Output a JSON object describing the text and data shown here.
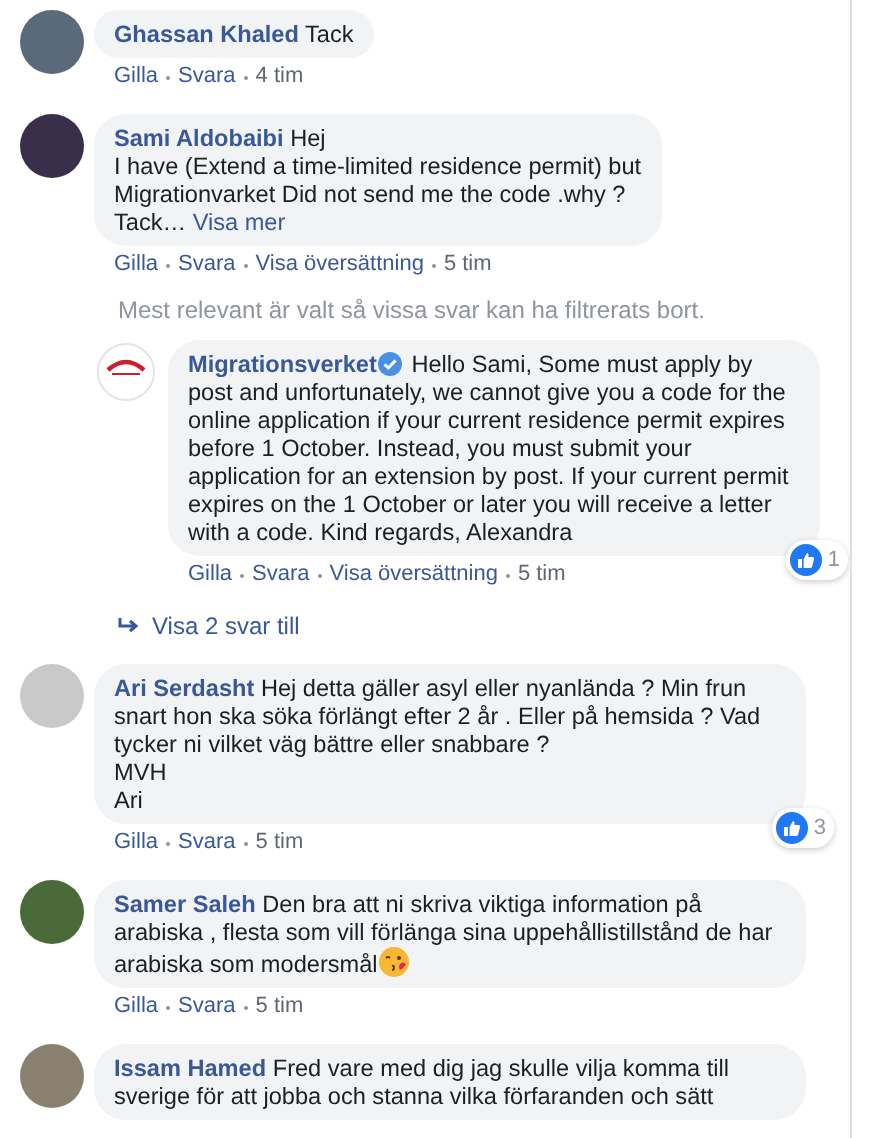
{
  "comments": [
    {
      "author": "Ghassan Khaled",
      "text": "Tack",
      "actions": [
        "Gilla",
        "Svara"
      ],
      "time": "4 tim"
    },
    {
      "author": "Sami Aldobaibi",
      "text": "Hej\nI have (Extend a time-limited residence permit) but\nMigrationvarket Did not send me the code .why ?\nTack…",
      "more_link": "Visa mer",
      "actions": [
        "Gilla",
        "Svara",
        "Visa översättning"
      ],
      "time": "5 tim",
      "filter_notice": "Mest relevant är valt så vissa svar kan ha filtrerats bort.",
      "replies": [
        {
          "author": "Migrationsverket",
          "verified": true,
          "text": "Hello Sami, Some must apply by post and unfortunately, we cannot give you a code for the online application if your current residence permit expires before 1 October. Instead, you must submit your application for an extension by post. If your current permit expires on the 1 October or later you will receive a letter with a code. Kind regards, Alexandra",
          "actions": [
            "Gilla",
            "Svara",
            "Visa översättning"
          ],
          "time": "5 tim",
          "reactions": "1"
        }
      ],
      "more_replies": "Visa 2 svar till"
    },
    {
      "author": "Ari Serdasht",
      "text": "Hej detta gäller asyl eller nyanlända ? Min frun snart hon ska söka förlängt efter 2 år . Eller på hemsida ? Vad tycker ni vilket väg bättre eller snabbare ?\nMVH\nAri",
      "actions": [
        "Gilla",
        "Svara"
      ],
      "time": "5 tim",
      "reactions": "3"
    },
    {
      "author": "Samer Saleh",
      "text": "Den bra att ni skriva viktiga information på arabiska , flesta som vill förlänga sina uppehållistillstånd de har arabiska som modersmål",
      "emoji": true,
      "actions": [
        "Gilla",
        "Svara"
      ],
      "time": "5 tim"
    },
    {
      "author": "Issam Hamed",
      "text": "Fred vare med dig jag skulle vilja komma till sverige för att jobba och stanna vilka förfaranden och sätt"
    }
  ]
}
